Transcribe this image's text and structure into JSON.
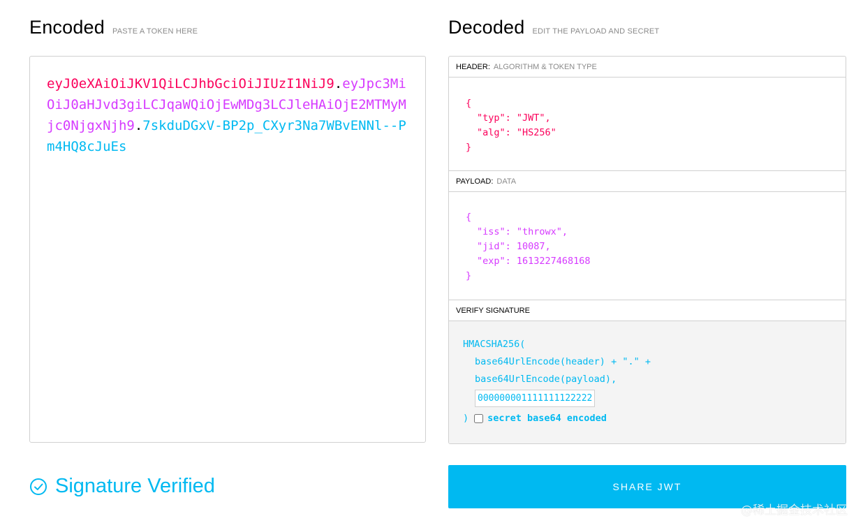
{
  "encoded": {
    "title": "Encoded",
    "subtitle": "PASTE A TOKEN HERE",
    "token_header": "eyJ0eXAiOiJKV1QiLCJhbGciOiJIUzI1NiJ9",
    "dot": ".",
    "token_payload": "eyJpc3MiOiJ0aHJvd3giLCJqaWQiOjEwMDg3LCJleHAiOjE2MTMyMjc0NjgxNjh9",
    "token_signature": "7skduDGxV-BP2p_CXyr3Na7WBvENNl--Pm4HQ8cJuEs"
  },
  "decoded": {
    "title": "Decoded",
    "subtitle": "EDIT THE PAYLOAD AND SECRET",
    "header_section": {
      "label": "HEADER:",
      "sublabel": "ALGORITHM & TOKEN TYPE",
      "lines": [
        "{",
        "\"typ\": \"JWT\",",
        "\"alg\": \"HS256\"",
        "}"
      ]
    },
    "payload_section": {
      "label": "PAYLOAD:",
      "sublabel": "DATA",
      "lines": [
        "{",
        "\"iss\": \"throwx\",",
        "\"jid\": 10087,",
        "\"exp\": 1613227468168",
        "}"
      ]
    },
    "signature_section": {
      "label": "VERIFY SIGNATURE",
      "fn_open": "HMACSHA256(",
      "line1": "base64UrlEncode(header) + \".\" +",
      "line2": "base64UrlEncode(payload),",
      "secret_value": "00000000111111112222222",
      "close": ")",
      "base64_label": "secret base64 encoded",
      "base64_checked": false
    }
  },
  "status": {
    "text": "Signature Verified",
    "icon": "check-circle-icon",
    "color": "#00b9f1"
  },
  "share_button": {
    "label": "SHARE JWT"
  },
  "watermark": "@稀土掘金技术社区",
  "colors": {
    "header": "#fb015b",
    "payload": "#d63aff",
    "signature": "#00b9f1"
  }
}
